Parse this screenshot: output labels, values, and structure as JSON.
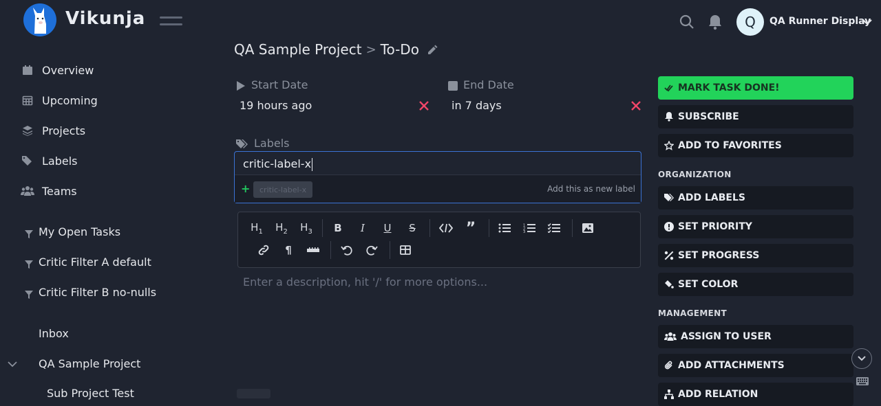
{
  "app": {
    "brand": "Vikunja"
  },
  "user": {
    "initial": "Q",
    "name": "QA Runner Display"
  },
  "sidebar": {
    "nav": [
      {
        "label": "Overview",
        "icon": "calendar-icon"
      },
      {
        "label": "Upcoming",
        "icon": "calendar-grid-icon"
      },
      {
        "label": "Projects",
        "icon": "layers-icon"
      },
      {
        "label": "Labels",
        "icon": "tags-icon"
      },
      {
        "label": "Teams",
        "icon": "users-icon"
      }
    ],
    "filters": [
      "My Open Tasks",
      "Critic Filter A default",
      "Critic Filter B no-nulls"
    ],
    "projects": [
      "Inbox",
      "QA Sample Project",
      "Sub Project Test"
    ]
  },
  "breadcrumb": {
    "project": "QA Sample Project",
    "separator": ">",
    "task": "To-Do"
  },
  "dates": {
    "start_label": "Start Date",
    "start_value": "19 hours ago",
    "end_label": "End Date",
    "end_value": "in 7 days"
  },
  "labels": {
    "heading": "Labels",
    "input_value": "critic-label-x",
    "suggestion_chip": "critic-label-x",
    "add_hint": "Add this as new label"
  },
  "editor": {
    "placeholder": "Enter a description, hit '/' for more options..."
  },
  "actions": {
    "mark_done": "MARK TASK DONE!",
    "subscribe": "SUBSCRIBE",
    "favorites": "ADD TO FAVORITES",
    "organization": "ORGANIZATION",
    "add_labels": "ADD LABELS",
    "set_priority": "SET PRIORITY",
    "set_progress": "SET PROGRESS",
    "set_color": "SET COLOR",
    "management": "MANAGEMENT",
    "assign_user": "ASSIGN TO USER",
    "add_attachments": "ADD ATTACHMENTS",
    "add_relation": "ADD RELATION"
  },
  "colors": {
    "accent": "#1e6fd9",
    "done": "#22d35a",
    "danger": "#f14668",
    "bg": "#1f2430"
  }
}
